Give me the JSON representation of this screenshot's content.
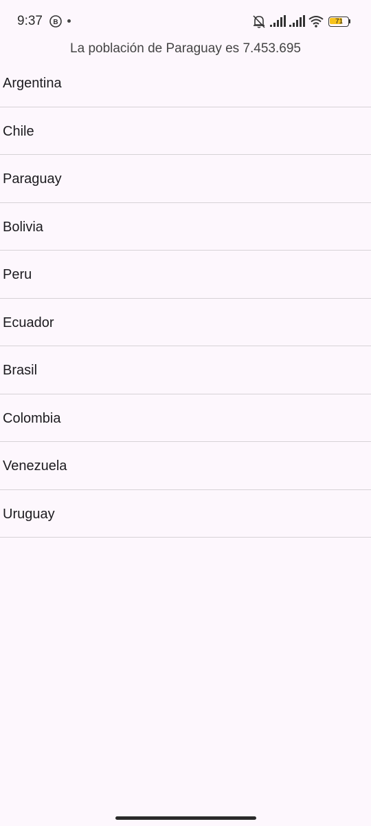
{
  "status_bar": {
    "time": "9:37",
    "battery_level": "71",
    "battery_fraction": 0.71,
    "icons": [
      "b-circle-icon",
      "dot-icon",
      "bell-off-icon",
      "signal-icon",
      "signal-icon",
      "wifi-icon",
      "battery-icon"
    ]
  },
  "header": {
    "text": "La población de Paraguay es 7.453.695"
  },
  "countries": [
    "Argentina",
    "Chile",
    "Paraguay",
    "Bolivia",
    "Peru",
    "Ecuador",
    "Brasil",
    "Colombia",
    "Venezuela",
    "Uruguay"
  ],
  "colors": {
    "background": "#fdf7fd",
    "divider": "#d6d2d6",
    "battery_fill": "#f7c21c"
  }
}
